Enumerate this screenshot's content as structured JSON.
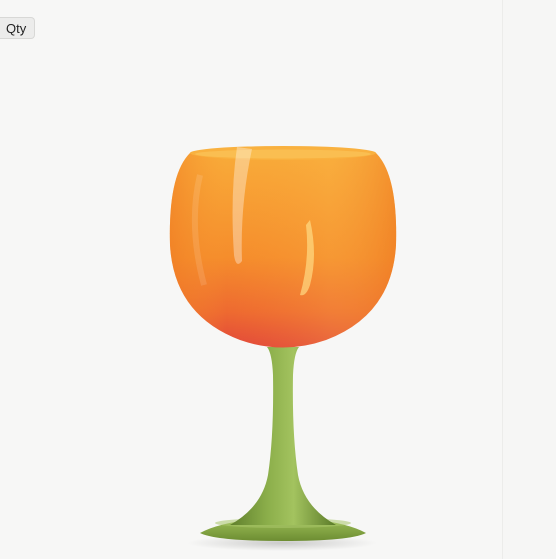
{
  "qty_button": {
    "label": "Qty"
  },
  "product_image": {
    "subject": "wine glass",
    "colors": {
      "background": "#f7f7f6",
      "bowl_top": "#f7a637",
      "bowl_mid": "#f4892a",
      "bowl_bottom": "#e2473a",
      "rim": "#f9b23c",
      "stem": "#7fa041",
      "stem_dark": "#5f7f2c",
      "foot": "#86a845"
    }
  }
}
